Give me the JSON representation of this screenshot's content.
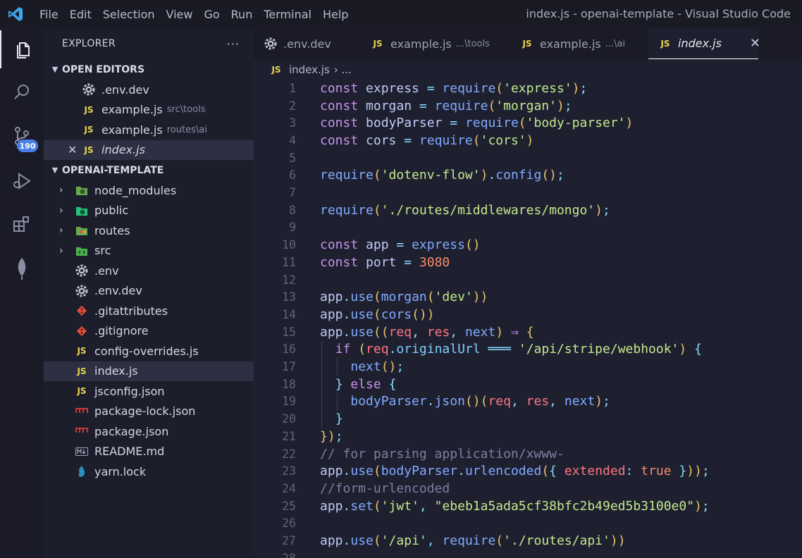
{
  "window": {
    "title": "index.js - openai-template - Visual Studio Code"
  },
  "menu": [
    "File",
    "Edit",
    "Selection",
    "View",
    "Go",
    "Run",
    "Terminal",
    "Help"
  ],
  "activity": {
    "scm_badge": "190"
  },
  "explorer": {
    "title": "EXPLORER",
    "more": "···",
    "open_editors_title": "OPEN EDITORS",
    "open_editors": [
      {
        "name": ".env.dev",
        "hint": "",
        "icon": "gear-icon"
      },
      {
        "name": "example.js",
        "hint": "src\\tools",
        "icon": "js-icon"
      },
      {
        "name": "example.js",
        "hint": "routes\\ai",
        "icon": "js-icon"
      },
      {
        "name": "index.js",
        "hint": "",
        "icon": "js-icon"
      }
    ],
    "project_title": "OPENAI-TEMPLATE",
    "tree": [
      {
        "name": "node_modules",
        "icon": "folder-node-icon"
      },
      {
        "name": "public",
        "icon": "folder-public-icon"
      },
      {
        "name": "routes",
        "icon": "folder-routes-icon"
      },
      {
        "name": "src",
        "icon": "folder-src-icon"
      },
      {
        "name": ".env",
        "icon": "gear-icon"
      },
      {
        "name": ".env.dev",
        "icon": "gear-icon"
      },
      {
        "name": ".gitattributes",
        "icon": "git-icon"
      },
      {
        "name": ".gitignore",
        "icon": "git-icon"
      },
      {
        "name": "config-overrides.js",
        "icon": "js-icon"
      },
      {
        "name": "index.js",
        "icon": "js-icon"
      },
      {
        "name": "jsconfig.json",
        "icon": "js-icon"
      },
      {
        "name": "package-lock.json",
        "icon": "npm-icon"
      },
      {
        "name": "package.json",
        "icon": "npm-icon"
      },
      {
        "name": "README.md",
        "icon": "markdown-icon"
      },
      {
        "name": "yarn.lock",
        "icon": "yarn-icon"
      }
    ]
  },
  "tabs": [
    {
      "label": ".env.dev",
      "hint": ""
    },
    {
      "label": "example.js",
      "hint": "...\\tools"
    },
    {
      "label": "example.js",
      "hint": "...\\ai"
    },
    {
      "label": "index.js",
      "hint": ""
    }
  ],
  "breadcrumb": {
    "file": "index.js",
    "more": "›  ..."
  },
  "js_label": "JS",
  "close_glyph": "✕",
  "editor": {
    "lines": [
      [
        [
          "kw",
          "const "
        ],
        [
          "id",
          "express "
        ],
        [
          "pn",
          "= "
        ],
        [
          "fn",
          "require"
        ],
        [
          "br",
          "("
        ],
        [
          "str",
          "'express'"
        ],
        [
          "br",
          ")"
        ],
        [
          "pn",
          ";"
        ]
      ],
      [
        [
          "kw",
          "const "
        ],
        [
          "id",
          "morgan "
        ],
        [
          "pn",
          "= "
        ],
        [
          "fn",
          "require"
        ],
        [
          "br",
          "("
        ],
        [
          "str",
          "'morgan'"
        ],
        [
          "br",
          ")"
        ],
        [
          "pn",
          ";"
        ]
      ],
      [
        [
          "kw",
          "const "
        ],
        [
          "id",
          "bodyParser "
        ],
        [
          "pn",
          "= "
        ],
        [
          "fn",
          "require"
        ],
        [
          "br",
          "("
        ],
        [
          "str",
          "'body-parser'"
        ],
        [
          "br",
          ")"
        ]
      ],
      [
        [
          "kw",
          "const "
        ],
        [
          "id",
          "cors "
        ],
        [
          "pn",
          "= "
        ],
        [
          "fn",
          "require"
        ],
        [
          "br",
          "("
        ],
        [
          "str",
          "'cors'"
        ],
        [
          "br",
          ")"
        ]
      ],
      [],
      [
        [
          "fn",
          "require"
        ],
        [
          "br",
          "("
        ],
        [
          "str",
          "'dotenv-flow'"
        ],
        [
          "br",
          ")"
        ],
        [
          "pn",
          "."
        ],
        [
          "fn",
          "config"
        ],
        [
          "br",
          "()"
        ],
        [
          "pn",
          ";"
        ]
      ],
      [],
      [
        [
          "fn",
          "require"
        ],
        [
          "br",
          "("
        ],
        [
          "str",
          "'./routes/middlewares/mongo'"
        ],
        [
          "br",
          ")"
        ],
        [
          "pn",
          ";"
        ]
      ],
      [],
      [
        [
          "kw",
          "const "
        ],
        [
          "id",
          "app "
        ],
        [
          "pn",
          "= "
        ],
        [
          "fn",
          "express"
        ],
        [
          "br",
          "()"
        ]
      ],
      [
        [
          "kw",
          "const "
        ],
        [
          "id",
          "port "
        ],
        [
          "pn",
          "= "
        ],
        [
          "num",
          "3080"
        ]
      ],
      [],
      [
        [
          "id",
          "app"
        ],
        [
          "pn",
          "."
        ],
        [
          "fn",
          "use"
        ],
        [
          "br",
          "("
        ],
        [
          "fn",
          "morgan"
        ],
        [
          "br",
          "("
        ],
        [
          "str",
          "'dev'"
        ],
        [
          "br",
          "))"
        ]
      ],
      [
        [
          "id",
          "app"
        ],
        [
          "pn",
          "."
        ],
        [
          "fn",
          "use"
        ],
        [
          "br",
          "("
        ],
        [
          "fn",
          "cors"
        ],
        [
          "br",
          "())"
        ]
      ],
      [
        [
          "id",
          "app"
        ],
        [
          "pn",
          "."
        ],
        [
          "fn",
          "use"
        ],
        [
          "br",
          "(("
        ],
        [
          "prm",
          "req"
        ],
        [
          "pn",
          ", "
        ],
        [
          "prm",
          "res"
        ],
        [
          "pn",
          ", "
        ],
        [
          "fn",
          "next"
        ],
        [
          "br",
          ") "
        ],
        [
          "kw",
          "⇒ "
        ],
        [
          "br",
          "{"
        ]
      ],
      [
        [
          "id",
          "  "
        ],
        [
          "kw",
          "if "
        ],
        [
          "br",
          "("
        ],
        [
          "prm",
          "req"
        ],
        [
          "pn",
          "."
        ],
        [
          "prop",
          "originalUrl "
        ],
        [
          "pn",
          "═══ "
        ],
        [
          "str",
          "'/api/stripe/webhook'"
        ],
        [
          "br",
          ") "
        ],
        [
          "pn",
          "{"
        ]
      ],
      [
        [
          "id",
          "    "
        ],
        [
          "fn",
          "next"
        ],
        [
          "br",
          "()"
        ],
        [
          "pn",
          ";"
        ]
      ],
      [
        [
          "id",
          "  "
        ],
        [
          "pn",
          "} "
        ],
        [
          "kw",
          "else "
        ],
        [
          "pn",
          "{"
        ]
      ],
      [
        [
          "id",
          "    "
        ],
        [
          "fn",
          "bodyParser"
        ],
        [
          "pn",
          "."
        ],
        [
          "fn",
          "json"
        ],
        [
          "br",
          "()("
        ],
        [
          "prm",
          "req"
        ],
        [
          "pn",
          ", "
        ],
        [
          "prm",
          "res"
        ],
        [
          "pn",
          ", "
        ],
        [
          "fn",
          "next"
        ],
        [
          "br",
          ")"
        ],
        [
          "pn",
          ";"
        ]
      ],
      [
        [
          "id",
          "  "
        ],
        [
          "pn",
          "}"
        ]
      ],
      [
        [
          "br",
          "})"
        ],
        [
          "pn",
          ";"
        ]
      ],
      [
        [
          "cm",
          "// for parsing application/xwww-"
        ]
      ],
      [
        [
          "id",
          "app"
        ],
        [
          "pn",
          "."
        ],
        [
          "fn",
          "use"
        ],
        [
          "br",
          "("
        ],
        [
          "fn",
          "bodyParser"
        ],
        [
          "pn",
          "."
        ],
        [
          "fn",
          "urlencoded"
        ],
        [
          "br",
          "("
        ],
        [
          "pn",
          "{ "
        ],
        [
          "prm",
          "extended"
        ],
        [
          "pn",
          ": "
        ],
        [
          "num",
          "true "
        ],
        [
          "pn",
          "}"
        ],
        [
          "br",
          ")"
        ],
        [
          "br",
          ")"
        ],
        [
          "pn",
          ";"
        ]
      ],
      [
        [
          "cm",
          "//form-urlencoded"
        ]
      ],
      [
        [
          "id",
          "app"
        ],
        [
          "pn",
          "."
        ],
        [
          "fn",
          "set"
        ],
        [
          "br",
          "("
        ],
        [
          "str",
          "'jwt'"
        ],
        [
          "pn",
          ", "
        ],
        [
          "str",
          "\"ebeb1a5ada5cf38bfc2b49ed5b3100e0\""
        ],
        [
          "br",
          ")"
        ],
        [
          "pn",
          ";"
        ]
      ],
      [],
      [
        [
          "id",
          "app"
        ],
        [
          "pn",
          "."
        ],
        [
          "fn",
          "use"
        ],
        [
          "br",
          "("
        ],
        [
          "str",
          "'/api'"
        ],
        [
          "pn",
          ", "
        ],
        [
          "fn",
          "require"
        ],
        [
          "br",
          "("
        ],
        [
          "str",
          "'./routes/api'"
        ],
        [
          "br",
          "))"
        ]
      ],
      []
    ]
  }
}
